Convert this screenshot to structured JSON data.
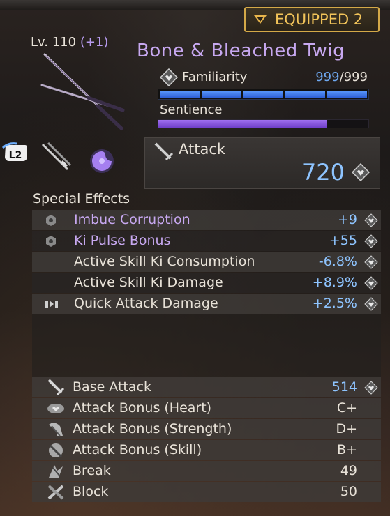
{
  "equipped": {
    "label": "EQUIPPED 2"
  },
  "weapon": {
    "level_prefix": "Lv. 110",
    "level_bonus": "(+1)",
    "name": "Bone & Bleached Twig",
    "familiarity_label": "Familiarity",
    "familiarity_current": "999",
    "familiarity_max": "/999",
    "familiarity_segments": 5,
    "sentience_label": "Sentience",
    "sentience_fraction": 0.8
  },
  "controls": {
    "l2_label": "L2"
  },
  "attack": {
    "label": "Attack",
    "value": "720"
  },
  "special_effects": {
    "title": "Special Effects",
    "rows": [
      {
        "name": "Imbue Corruption",
        "value": "+9",
        "icon": "hex-icon",
        "style": "purple"
      },
      {
        "name": "Ki Pulse Bonus",
        "value": "+55",
        "icon": "hex-icon",
        "style": "purple"
      },
      {
        "name": "Active Skill Ki Consumption",
        "value": "-6.8%",
        "icon": "",
        "style": "normal"
      },
      {
        "name": "Active Skill Ki Damage",
        "value": "+8.9%",
        "icon": "",
        "style": "normal"
      },
      {
        "name": "Quick Attack Damage",
        "value": "+2.5%",
        "icon": "quick-attack-icon",
        "style": "normal"
      }
    ]
  },
  "stats": [
    {
      "name": "Base Attack",
      "value": "514",
      "icon": "sword-icon",
      "blue": true
    },
    {
      "name": "Attack Bonus (Heart)",
      "value": "C+",
      "icon": "heart-bonus-icon",
      "blue": false
    },
    {
      "name": "Attack Bonus (Strength)",
      "value": "D+",
      "icon": "strength-bonus-icon",
      "blue": false
    },
    {
      "name": "Attack Bonus (Skill)",
      "value": "B+",
      "icon": "skill-bonus-icon",
      "blue": false
    },
    {
      "name": "Break",
      "value": "49",
      "icon": "break-icon",
      "blue": false
    },
    {
      "name": "Block",
      "value": "50",
      "icon": "block-icon",
      "blue": false
    }
  ],
  "colors": {
    "accent_gold": "#d4a948",
    "value_blue": "#8ec4ff",
    "name_purple": "#c7a8f0",
    "familiarity_blue": "#5b9bff",
    "sentience_purple": "#a070f0"
  }
}
